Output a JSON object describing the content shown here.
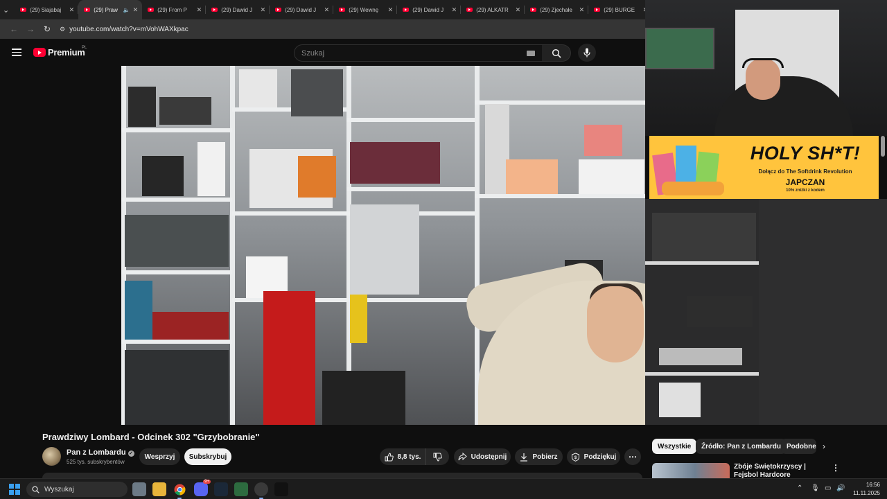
{
  "browser": {
    "tabs": [
      {
        "title": "(29) Siajabaj",
        "active": false,
        "audio": false
      },
      {
        "title": "(29) Praw",
        "active": true,
        "audio": true
      },
      {
        "title": "(29) From P",
        "active": false,
        "audio": false
      },
      {
        "title": "(29) Dawid J",
        "active": false,
        "audio": false
      },
      {
        "title": "(29) Dawid J",
        "active": false,
        "audio": false
      },
      {
        "title": "(29) Wewnę",
        "active": false,
        "audio": false
      },
      {
        "title": "(29) Dawid J",
        "active": false,
        "audio": false
      },
      {
        "title": "(29) ALKATR",
        "active": false,
        "audio": false
      },
      {
        "title": "(29) Zjechałe",
        "active": false,
        "audio": false
      },
      {
        "title": "(29) BURGE",
        "active": false,
        "audio": false
      }
    ],
    "url": "youtube.com/watch?v=mVohWAXkpac"
  },
  "header": {
    "logo_text": "Premium",
    "country": "PL",
    "search_placeholder": "Szukaj"
  },
  "video": {
    "title": "Prawdziwy Lombard - Odcinek 302 \"Grzybobranie\""
  },
  "channel": {
    "name": "Pan z Lombardu",
    "subscribers": "525 tys. subskrybentów",
    "join_label": "Wesprzyj",
    "subscribe_label": "Subskrybuj"
  },
  "actions": {
    "likes": "8,8 tys.",
    "share": "Udostępnij",
    "download": "Pobierz",
    "thanks": "Podziękuj"
  },
  "overlay_ad": {
    "title": "HOLY SH*T!",
    "subtitle": "Dołącz do The Softdrink Revolution",
    "code": "JAPCZAN",
    "promo": "10% zniżki z kodem"
  },
  "chips": [
    "Wszystkie",
    "Źródło: Pan z Lombardu",
    "Podobne"
  ],
  "recommendation": {
    "title": "Zbóje Świętokrzyscy | Fejsbol Hardcore"
  },
  "taskbar": {
    "search_placeholder": "Wyszukaj",
    "discord_badge": "9+",
    "time": "16:56",
    "date": "11.11.2025"
  },
  "colors": {
    "yt_red": "#ff0033",
    "background": "#0f0f0f",
    "button_bg": "#272727",
    "ad_yellow": "#ffc43d"
  }
}
